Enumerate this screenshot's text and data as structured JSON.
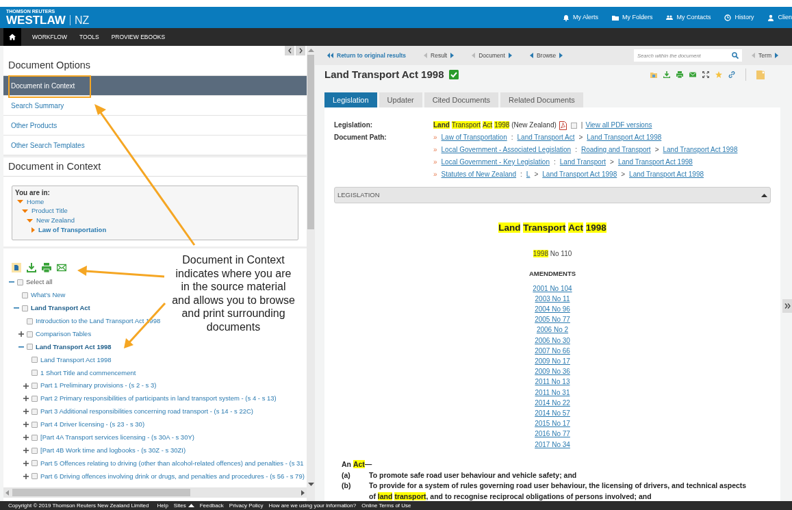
{
  "header": {
    "brand_top": "THOMSON REUTERS",
    "brand": "WESTLAW",
    "region": "NZ",
    "links": [
      {
        "label": "My Alerts"
      },
      {
        "label": "My Folders"
      },
      {
        "label": "My Contacts"
      },
      {
        "label": "History"
      },
      {
        "label": "Clien"
      }
    ]
  },
  "nav": {
    "items": [
      "WORKFLOW",
      "TOOLS",
      "PROVIEW EBOOKS"
    ]
  },
  "left": {
    "options_title": "Document Options",
    "options": [
      {
        "label": "Document in Context",
        "selected": true
      },
      {
        "label": "Search Summary",
        "selected": false
      },
      {
        "label": "Other Products",
        "selected": false
      },
      {
        "label": "Other Search Templates",
        "selected": false
      }
    ],
    "context_title": "Document in Context",
    "you_are_in": {
      "label": "You are in:",
      "path": [
        {
          "label": "Home",
          "expanded": true,
          "children": [
            {
              "label": "Product Title",
              "expanded": true,
              "children": [
                {
                  "label": "New Zealand",
                  "expanded": true,
                  "children": [
                    {
                      "label": "Law of Transportation",
                      "expanded": false
                    }
                  ]
                }
              ]
            }
          ]
        }
      ]
    },
    "tree": [
      {
        "label": "Select all",
        "kind": "root",
        "checked": false,
        "expanded": true,
        "children": [
          {
            "label": "What's New",
            "kind": "item",
            "checked": false
          },
          {
            "label": "Land Transport Act",
            "kind": "path",
            "checked": false,
            "expanded": true,
            "children": [
              {
                "label": "Introduction to the Land Transport Act 1998",
                "kind": "item",
                "checked": false
              },
              {
                "label": "Comparison Tables",
                "kind": "item",
                "checked": false,
                "expanded": false
              },
              {
                "label": "Land Transport Act 1998",
                "kind": "path",
                "checked": false,
                "expanded": true,
                "children": [
                  {
                    "label": "Land Transport Act 1998",
                    "kind": "item",
                    "checked": false
                  },
                  {
                    "label": "1 Short Title and commencement",
                    "kind": "item",
                    "checked": false
                  },
                  {
                    "label": "Part 1 Preliminary provisions - (s 2 - s 3)",
                    "kind": "item",
                    "checked": false,
                    "expanded": false
                  },
                  {
                    "label": "Part 2 Primary responsibilities of participants in land transport system - (s 4 - s 13)",
                    "kind": "item",
                    "checked": false,
                    "expanded": false
                  },
                  {
                    "label": "Part 3 Additional responsibilities concerning road transport - (s 14 - s 22C)",
                    "kind": "item",
                    "checked": false,
                    "expanded": false
                  },
                  {
                    "label": "Part 4 Driver licensing - (s 23 - s 30)",
                    "kind": "item",
                    "checked": false,
                    "expanded": false
                  },
                  {
                    "label": "[Part 4A Transport services licensing - (s 30A - s 30Y)",
                    "kind": "item",
                    "checked": false,
                    "expanded": false
                  },
                  {
                    "label": "[Part 4B Work time and logbooks - (s 30Z - s 30ZI)",
                    "kind": "item",
                    "checked": false,
                    "expanded": false
                  },
                  {
                    "label": "Part 5 Offences relating to driving (other than alcohol-related offences) and penalties - (s 31",
                    "kind": "item",
                    "checked": false,
                    "expanded": false
                  },
                  {
                    "label": "Part 6 Driving offences involving drink or drugs, and penalties and procedures - (s 56 - s 79)",
                    "kind": "item",
                    "checked": false,
                    "expanded": false
                  }
                ]
              }
            ]
          }
        ]
      }
    ]
  },
  "right": {
    "toolbar": {
      "back": "Return to original results",
      "navs": [
        "Result",
        "Document",
        "Browse"
      ],
      "search_placeholder": "Search within the document",
      "term": "Term"
    },
    "title": "Land Transport Act 1998",
    "verified": true,
    "tabs": [
      {
        "label": "Legislation",
        "selected": true
      },
      {
        "label": "Updater",
        "selected": false
      },
      {
        "label": "Cited Documents",
        "selected": false
      },
      {
        "label": "Related Documents",
        "selected": false
      }
    ],
    "meta": {
      "legislation_label": "Legislation:",
      "legislation": [
        {
          "text": "**Land**",
          "highlight": true
        },
        {
          "text": "Transport",
          "highlight": true
        },
        {
          "text": "Act",
          "highlight": true
        },
        {
          "text": "1998",
          "highlight": true
        },
        {
          "text": "(New Zealand)",
          "highlight": false
        }
      ],
      "pdf_checked": false,
      "pdf_link": "View all PDF versions",
      "divider": "|",
      "path_label": "Document Path:",
      "paths": [
        {
          "marker": "»",
          "parts": [
            {
              "text": "Law of Transportation"
            },
            {
              "sep": ":",
              "text": "Land Transport Act"
            },
            {
              "sep": ">",
              "text": "Land Transport Act 1998"
            }
          ]
        },
        {
          "marker": "»",
          "parts": [
            {
              "text": "Local Government - Associated Legislation"
            },
            {
              "sep": ":",
              "text": "Roading and Transport"
            },
            {
              "sep": ">",
              "text": "Land Transport Act 1998"
            }
          ]
        },
        {
          "marker": "»",
          "parts": [
            {
              "text": "Local Government - Key Legislation"
            },
            {
              "sep": ":",
              "text": "Land Transport"
            },
            {
              "sep": ">",
              "text": "Land Transport Act 1998"
            }
          ]
        },
        {
          "marker": "»",
          "parts": [
            {
              "text": "Statutes of New Zealand"
            },
            {
              "sep": ":",
              "text": "L"
            },
            {
              "sep": ">",
              "text": "Land Transport Act 1998"
            },
            {
              "sep": ">",
              "text": "Land Transport Act 1998"
            }
          ]
        }
      ]
    },
    "section": {
      "label": "LEGISLATION",
      "expanded": true
    },
    "document": {
      "title": [
        {
          "text": "Land",
          "highlight": true
        },
        {
          "text": "Transport",
          "highlight": true
        },
        {
          "text": "Act",
          "highlight": true
        },
        {
          "text": "1998",
          "highlight": true
        }
      ],
      "number": [
        {
          "text": "1998",
          "highlight": true
        },
        {
          "text": "No 110",
          "highlight": false
        }
      ],
      "amendments_title": "AMENDMENTS",
      "amendments": [
        "2001 No 104",
        "2003 No 11",
        "2004 No 96",
        "2005 No 77",
        "2006 No 2",
        "2006 No 30",
        "2007 No 66",
        "2009 No 17",
        "2009 No 36",
        "2011 No 13",
        "2011 No 31",
        "2014 No 22",
        "2014 No 57",
        "2015 No 17",
        "2016 No 77",
        "2017 No 34"
      ],
      "preamble": [
        {
          "text": "An",
          "highlight": false
        },
        {
          "text": "Act",
          "highlight": true
        },
        {
          "text": "—",
          "highlight": false,
          "attached": true
        }
      ],
      "clauses": [
        {
          "label": "(a)",
          "segments": [
            {
              "text": "To promote safe road user behaviour and vehicle safety; and",
              "highlight": false
            }
          ]
        },
        {
          "label": "(b)",
          "segments": [
            {
              "text": "To provide for a system of rules governing road user behaviour, the licensing of drivers, and technical aspects of",
              "highlight": false
            },
            {
              "text": "land",
              "highlight": true
            },
            {
              "text": "transport",
              "highlight": true
            },
            {
              "text": ", and to recognise reciprocal obligations of persons involved; and",
              "highlight": false,
              "attached": true
            }
          ]
        }
      ]
    }
  },
  "footer": {
    "copyright": "Copyright © 2019 Thomson Reuters New Zealand Limited",
    "links": [
      {
        "label": "Help",
        "menu": false
      },
      {
        "label": "Sites",
        "menu": true
      },
      {
        "label": "Feedback",
        "menu": false
      },
      {
        "label": "Privacy Policy",
        "menu": false
      },
      {
        "label": "How are we using your information?",
        "menu": false
      },
      {
        "label": "Online Terms of Use",
        "menu": false
      }
    ]
  },
  "callout": {
    "text": "Document in Context indicates where you are in the source material and allows you to browse and print surrounding documents"
  }
}
